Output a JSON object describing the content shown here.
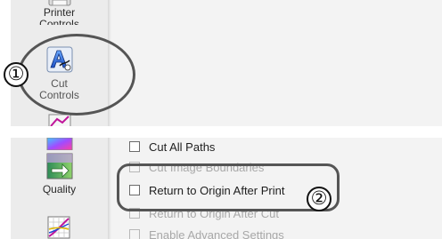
{
  "top_panel": {
    "sidebar_items": [
      {
        "label": "Printer",
        "icon": "printer-icon"
      },
      {
        "label": "Controls",
        "icon": ""
      },
      {
        "label": "Cut",
        "icon": "cut-controls-icon"
      },
      {
        "label": "Controls",
        "icon": ""
      }
    ]
  },
  "bottom_panel": {
    "sidebar_items": [
      {
        "label": "Quality",
        "icon": "quality-icon"
      },
      {
        "label": "",
        "icon": "color-graph-icon"
      }
    ],
    "options": [
      {
        "label": "Cut All Paths",
        "checked": false,
        "enabled": true
      },
      {
        "label": "Cut Image Boundaries",
        "checked": false,
        "enabled": false
      },
      {
        "label": "Return to Origin After Print",
        "checked": false,
        "enabled": true
      },
      {
        "label": "Return to Origin After Cut",
        "checked": false,
        "enabled": false
      },
      {
        "label": "Enable Advanced Settings",
        "checked": false,
        "enabled": false
      }
    ]
  },
  "callouts": [
    {
      "number": "①"
    },
    {
      "number": "②"
    }
  ],
  "colors": {
    "sidebar_bg": "#ececec",
    "content_bg": "#f3f3f3",
    "callout_ring": "#555555"
  }
}
